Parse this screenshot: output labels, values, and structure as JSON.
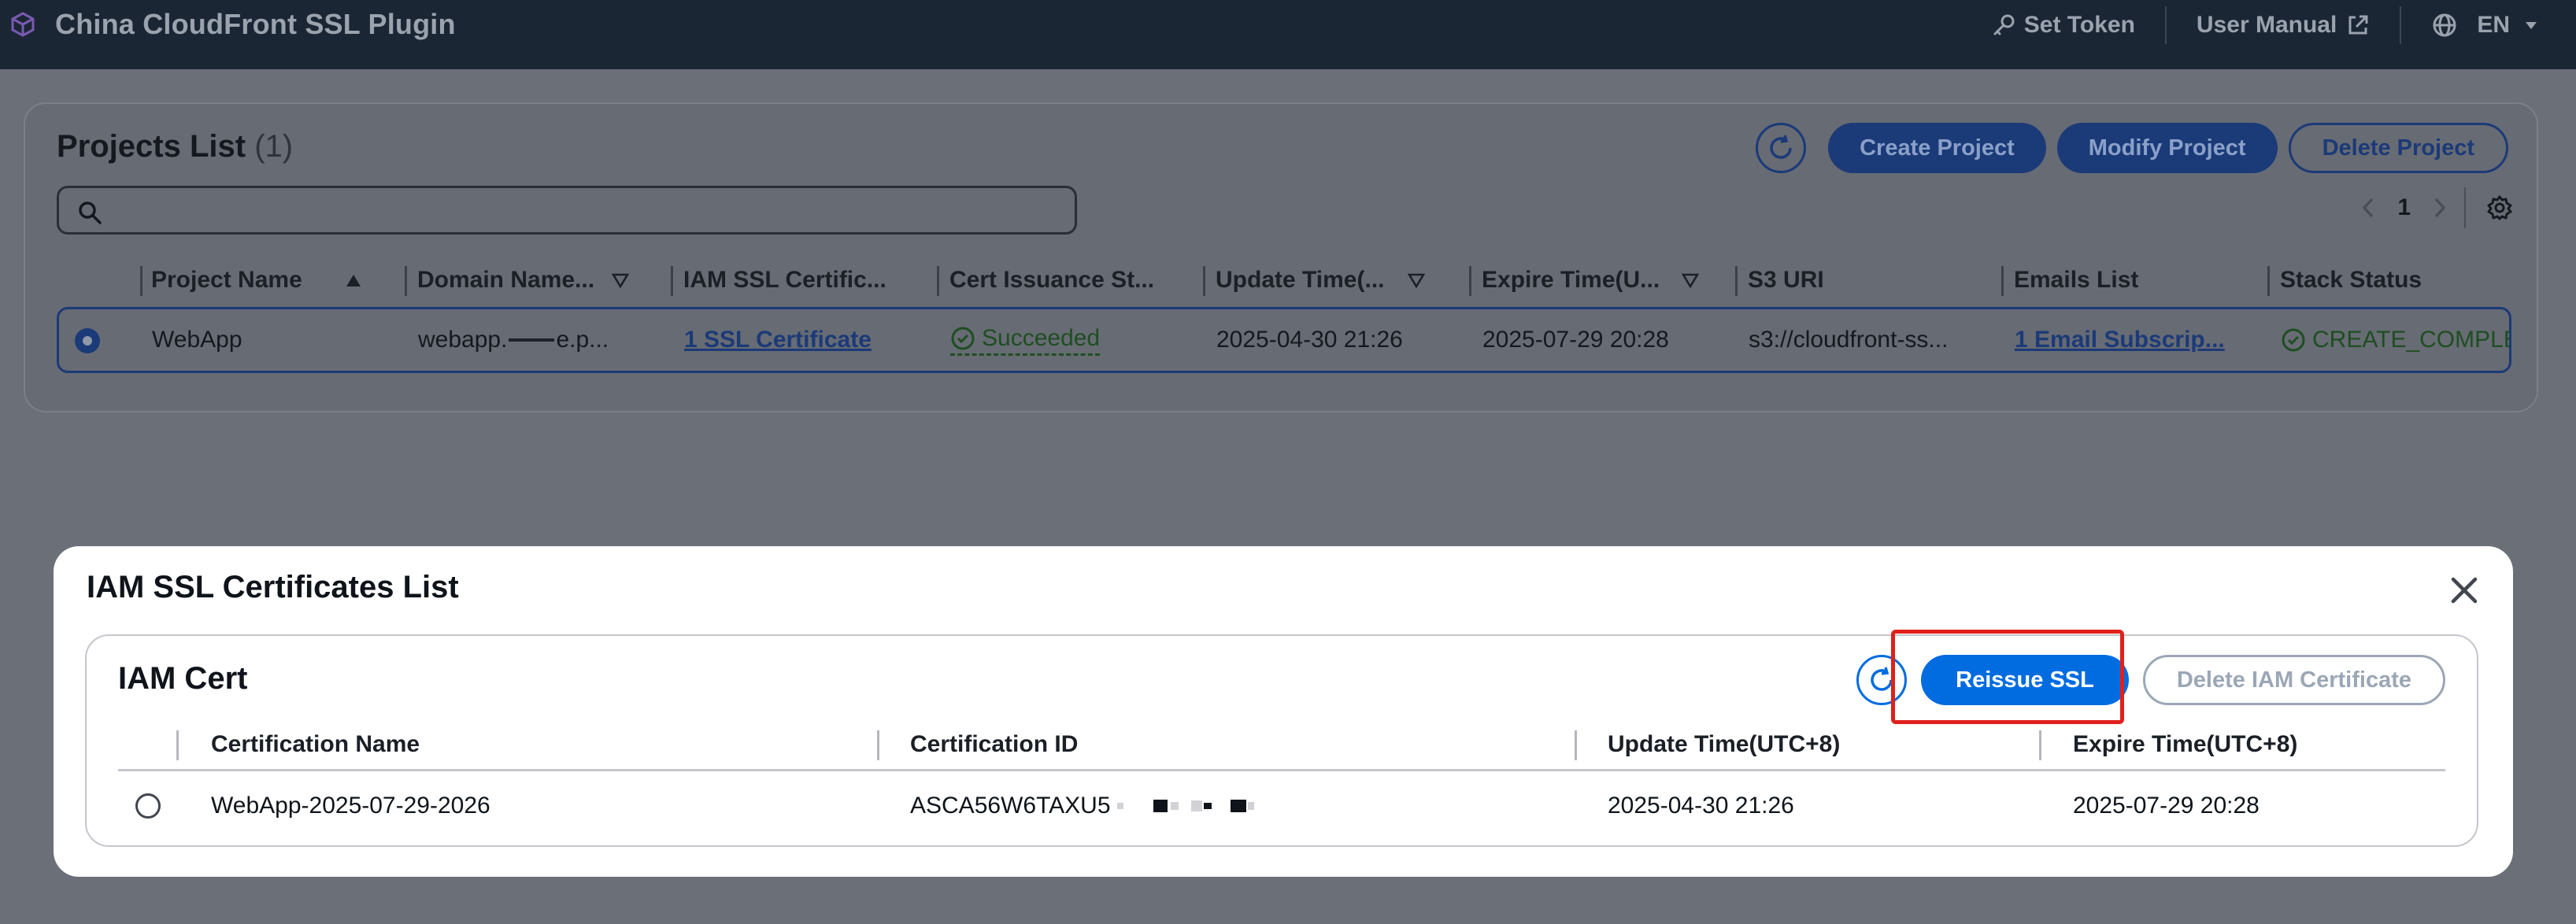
{
  "nav": {
    "title": "China CloudFront SSL Plugin",
    "set_token": "Set Token",
    "user_manual": "User Manual",
    "language": "EN"
  },
  "projects": {
    "title": "Projects List",
    "count": "(1)",
    "buttons": {
      "create": "Create Project",
      "modify": "Modify Project",
      "delete": "Delete Project"
    },
    "search_placeholder": "",
    "page": "1",
    "columns": [
      "Project Name",
      "Domain Name...",
      "IAM SSL Certific...",
      "Cert Issuance St...",
      "Update Time(...",
      "Expire Time(U...",
      "S3 URI",
      "Emails List",
      "Stack Status"
    ],
    "row": {
      "project_name": "WebApp",
      "domain_prefix": "webapp.",
      "domain_suffix": "e.p...",
      "iam_ssl": "1 SSL Certificate",
      "cert_status": "Succeeded",
      "update_time": "2025-04-30 21:26",
      "expire_time": "2025-07-29 20:28",
      "s3_uri": "s3://cloudfront-ss...",
      "emails": "1 Email Subscrip...",
      "stack_status": "CREATE_COMPLETE"
    }
  },
  "modal": {
    "title": "IAM SSL Certificates List",
    "card_title": "IAM Cert",
    "reissue": "Reissue SSL",
    "delete": "Delete IAM Certificate",
    "columns": [
      "Certification Name",
      "Certification ID",
      "Update Time(UTC+8)",
      "Expire Time(UTC+8)"
    ],
    "row": {
      "name": "WebApp-2025-07-29-2026",
      "id": "ASCA56W6TAXU5",
      "update_time": "2025-04-30 21:26",
      "expire_time": "2025-07-29 20:28"
    }
  },
  "colors": {
    "primary": "#006ce0",
    "highlight": "#e0201b",
    "nav_bg": "#1b2635",
    "success": "#1e4e22"
  }
}
